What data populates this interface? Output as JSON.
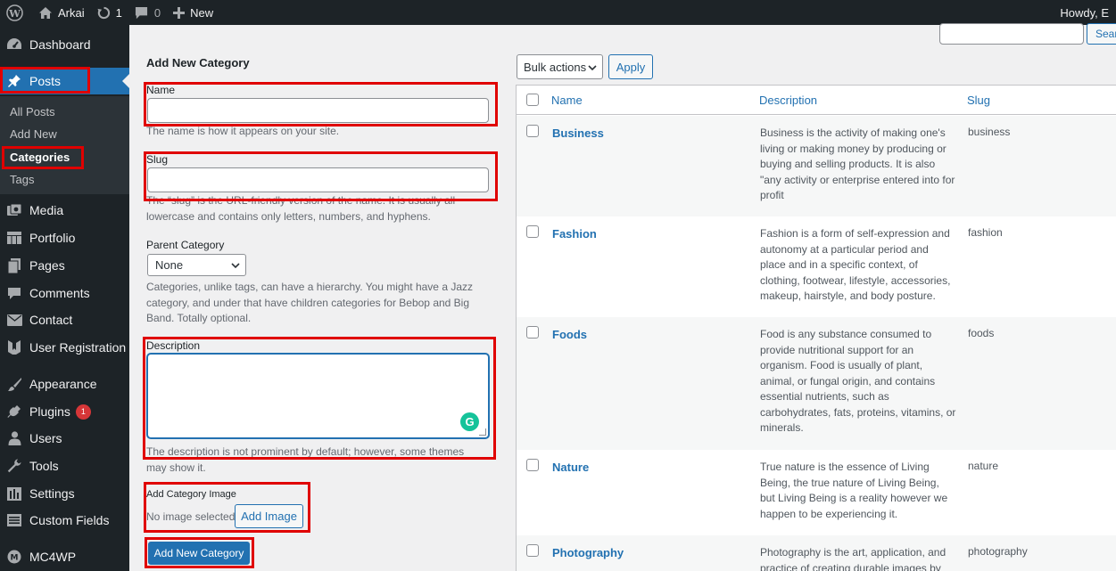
{
  "adminbar": {
    "site_name": "Arkai",
    "updates_count": "1",
    "comments_count": "0",
    "new_label": "New",
    "howdy": "Howdy, E"
  },
  "sidebar": {
    "dashboard": "Dashboard",
    "posts": "Posts",
    "submenu": [
      "All Posts",
      "Add New",
      "Categories",
      "Tags"
    ],
    "media": "Media",
    "portfolio": "Portfolio",
    "pages": "Pages",
    "comments": "Comments",
    "contact": "Contact",
    "user_registration": "User Registration",
    "appearance": "Appearance",
    "plugins": "Plugins",
    "plugins_badge": "1",
    "users": "Users",
    "tools": "Tools",
    "settings": "Settings",
    "custom_fields": "Custom Fields",
    "mc4wp": "MC4WP"
  },
  "form": {
    "heading": "Add New Category",
    "name_label": "Name",
    "name_help": "The name is how it appears on your site.",
    "slug_label": "Slug",
    "slug_help": "The “slug” is the URL-friendly version of the name. It is usually all lowercase and contains only letters, numbers, and hyphens.",
    "parent_label": "Parent Category",
    "parent_value": "None",
    "parent_help": "Categories, unlike tags, can have a hierarchy. You might have a Jazz category, and under that have children categories for Bebop and Big Band. Totally optional.",
    "description_label": "Description",
    "description_help": "The description is not prominent by default; however, some themes may show it.",
    "image_label": "Add Category Image",
    "no_image": "No image selected",
    "add_image_button": "Add Image",
    "submit_button": "Add New Category"
  },
  "list": {
    "search_button": "Sear",
    "bulk_actions": "Bulk actions",
    "apply_button": "Apply",
    "columns": [
      "Name",
      "Description",
      "Slug"
    ],
    "rows": [
      {
        "name": "Business",
        "description": "Business is the activity of making one's living or making money by producing or buying and selling products. It is also \"any activity or enterprise entered into for profit",
        "slug": "business"
      },
      {
        "name": "Fashion",
        "description": "Fashion is a form of self-expression and autonomy at a particular period and place and in a specific context, of clothing, footwear, lifestyle, accessories, makeup, hairstyle, and body posture.",
        "slug": "fashion"
      },
      {
        "name": "Foods",
        "description": "Food is any substance consumed to provide nutritional support for an organism. Food is usually of plant, animal, or fungal origin, and contains essential nutrients, such as carbohydrates, fats, proteins, vitamins, or minerals.",
        "slug": "foods"
      },
      {
        "name": "Nature",
        "description": "True nature is the essence of Living Being, the true nature of Living Being, but Living Being is a reality however we happen to be experiencing it.",
        "slug": "nature"
      },
      {
        "name": "Photography",
        "description": "Photography is the art, application, and practice of creating durable images by",
        "slug": "photography"
      }
    ]
  },
  "colors": {
    "admin_dark": "#1d2327",
    "accent_blue": "#2271b1",
    "highlight_red": "#e00000"
  }
}
